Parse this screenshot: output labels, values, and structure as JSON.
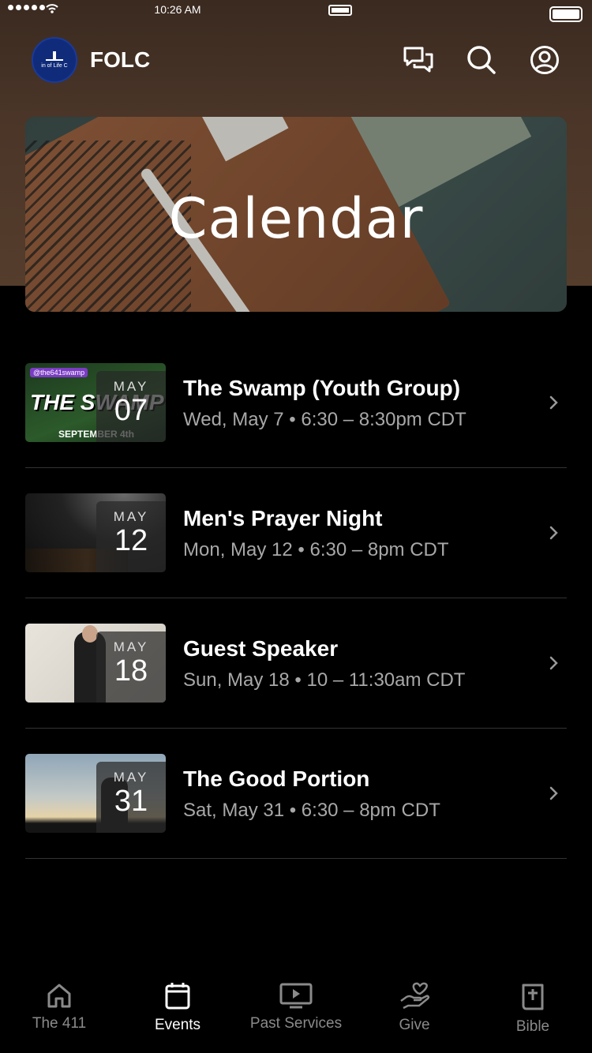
{
  "status_bar": {
    "time": "10:26 AM"
  },
  "app": {
    "title": "FOLC",
    "logo_text": "in of Life C"
  },
  "hero": {
    "title": "Calendar"
  },
  "events": [
    {
      "title": "The Swamp (Youth Group)",
      "subtitle": "Wed, May 7 • 6:30 – 8:30pm CDT",
      "month": "MAY",
      "day": "07",
      "thumb_tag": "@the641swamp",
      "thumb_big": "THE SWAMP",
      "thumb_foot": "SEPTEMBER 4th"
    },
    {
      "title": "Men's Prayer Night",
      "subtitle": "Mon, May 12 • 6:30 – 8pm CDT",
      "month": "MAY",
      "day": "12"
    },
    {
      "title": "Guest Speaker",
      "subtitle": "Sun, May 18 • 10 – 11:30am CDT",
      "month": "MAY",
      "day": "18"
    },
    {
      "title": "The Good Portion",
      "subtitle": "Sat, May 31 • 6:30 – 8pm CDT",
      "month": "MAY",
      "day": "31"
    }
  ],
  "tabs": [
    {
      "label": "The 411",
      "icon": "home-icon",
      "active": false
    },
    {
      "label": "Events",
      "icon": "calendar-icon",
      "active": true
    },
    {
      "label": "Past Services",
      "icon": "tv-play-icon",
      "active": false
    },
    {
      "label": "Give",
      "icon": "give-heart-icon",
      "active": false
    },
    {
      "label": "Bible",
      "icon": "bible-icon",
      "active": false
    }
  ],
  "colors": {
    "background": "#000000",
    "header": "#4a3528",
    "text_secondary": "#a8a8a8",
    "tab_inactive": "#8a8a8a"
  }
}
